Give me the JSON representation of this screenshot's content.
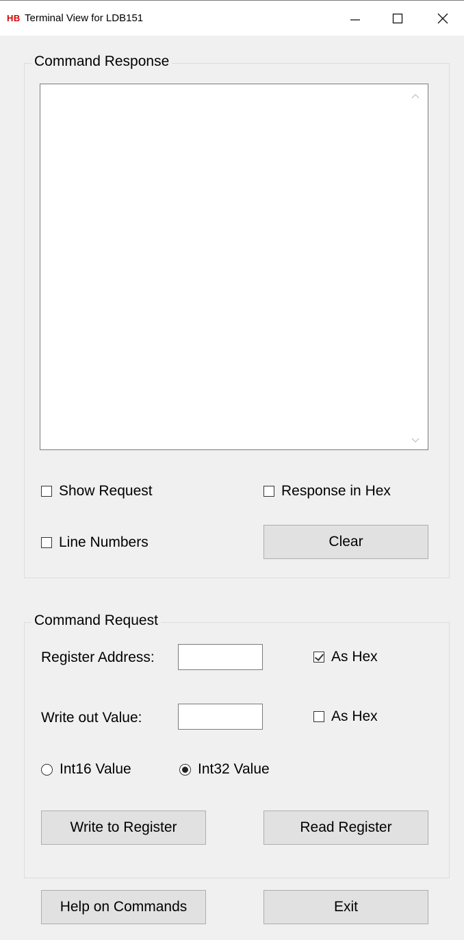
{
  "window": {
    "icon_text": "HB",
    "title": "Terminal View for LDB151",
    "minimize_glyph": "—",
    "maximize_glyph": "☐",
    "close_glyph": "✕"
  },
  "response_group": {
    "title": "Command Response",
    "text": "",
    "show_request": {
      "label": "Show Request",
      "checked": false
    },
    "response_in_hex": {
      "label": "Response in Hex",
      "checked": false
    },
    "line_numbers": {
      "label": "Line Numbers",
      "checked": false
    },
    "clear_button": "Clear"
  },
  "request_group": {
    "title": "Command Request",
    "register_address": {
      "label": "Register Address:",
      "value": ""
    },
    "register_as_hex": {
      "label": "As Hex",
      "checked": true
    },
    "write_value": {
      "label": "Write out Value:",
      "value": ""
    },
    "write_as_hex": {
      "label": "As Hex",
      "checked": false
    },
    "int16": {
      "label": "Int16 Value",
      "selected": false
    },
    "int32": {
      "label": "Int32 Value",
      "selected": true
    },
    "write_button": "Write to Register",
    "read_button": "Read Register"
  },
  "footer": {
    "help_button": "Help on Commands",
    "exit_button": "Exit"
  }
}
